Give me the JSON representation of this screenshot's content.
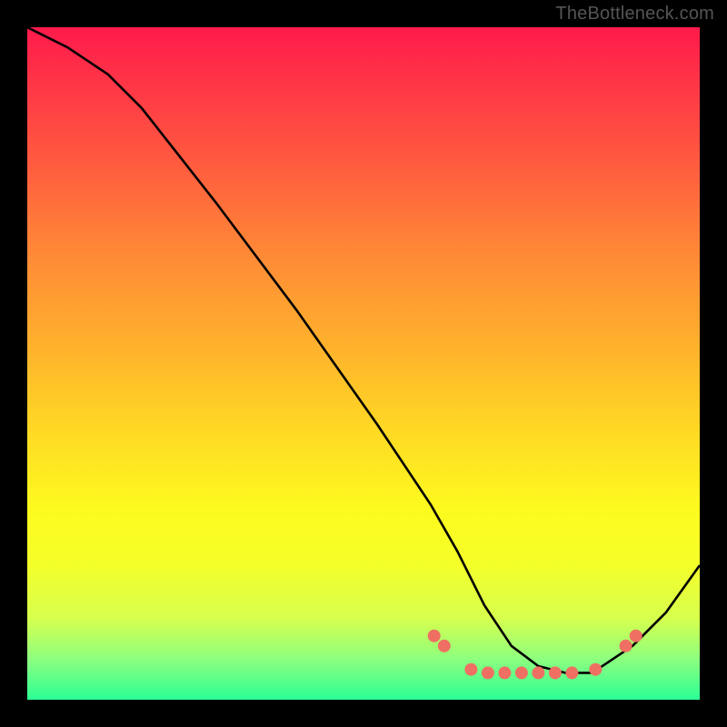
{
  "watermark": "TheBottleneck.com",
  "chart_data": {
    "type": "line",
    "title": "",
    "xlabel": "",
    "ylabel": "",
    "xlim": [
      0,
      100
    ],
    "ylim": [
      0,
      100
    ],
    "grid": false,
    "legend": false,
    "series": [
      {
        "name": "curve",
        "x": [
          0,
          6,
          12,
          17,
          28,
          40,
          52,
          60,
          64,
          68,
          72,
          76,
          80,
          84,
          90,
          95,
          100
        ],
        "y": [
          100,
          97,
          93,
          88,
          74,
          58,
          41,
          29,
          22,
          14,
          8,
          5,
          4,
          4,
          8,
          13,
          20
        ]
      }
    ],
    "markers": {
      "name": "dots",
      "color": "#ef6f63",
      "points": [
        {
          "x": 60.5,
          "y": 9.5
        },
        {
          "x": 62.0,
          "y": 8.0
        },
        {
          "x": 66.0,
          "y": 4.5
        },
        {
          "x": 68.5,
          "y": 4.0
        },
        {
          "x": 71.0,
          "y": 4.0
        },
        {
          "x": 73.5,
          "y": 4.0
        },
        {
          "x": 76.0,
          "y": 4.0
        },
        {
          "x": 78.5,
          "y": 4.0
        },
        {
          "x": 81.0,
          "y": 4.0
        },
        {
          "x": 84.5,
          "y": 4.5
        },
        {
          "x": 89.0,
          "y": 8.0
        },
        {
          "x": 90.5,
          "y": 9.5
        }
      ]
    }
  }
}
